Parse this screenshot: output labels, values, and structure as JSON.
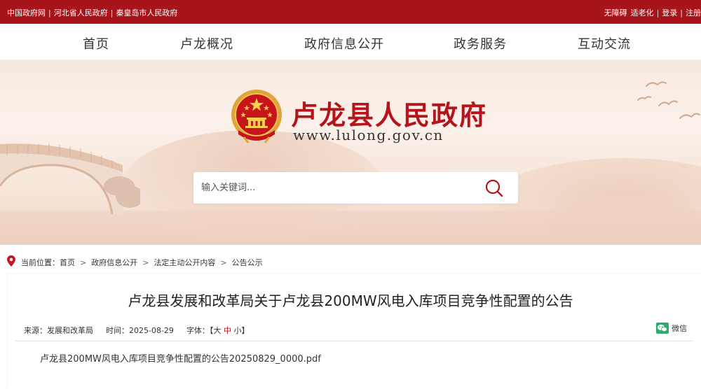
{
  "topbar": {
    "links_left": [
      "中国政府网",
      "河北省人民政府",
      "秦皇岛市人民政府"
    ],
    "links_right": [
      "无障碍",
      "适老化",
      "登录",
      "注册"
    ]
  },
  "nav": {
    "items": [
      "首页",
      "卢龙概况",
      "政府信息公开",
      "政务服务",
      "互动交流"
    ]
  },
  "banner": {
    "site_title": "卢龙县人民政府",
    "site_url": "www.lulong.gov.cn"
  },
  "search": {
    "placeholder": "输入关键词..."
  },
  "breadcrumb": {
    "label": "当前位置：",
    "items": [
      "首页",
      "政府信息公开",
      "法定主动公开内容",
      "公告公示"
    ]
  },
  "article": {
    "title": "卢龙县发展和改革局关于卢龙县200MW风电入库项目竞争性配置的公告",
    "source": "来源：发展和改革局",
    "time": "时间：2025-08-29",
    "fontsize_label": "字体：【",
    "fontsize_large": "大",
    "fontsize_medium": "中",
    "fontsize_small": "小",
    "fontsize_end": "】",
    "share_label": "微信",
    "attachment": "卢龙县200MW风电入库项目竞争性配置的公告20250829_0000.pdf"
  },
  "colors": {
    "brand_red": "#a7151b",
    "title_red": "#b5141a"
  }
}
